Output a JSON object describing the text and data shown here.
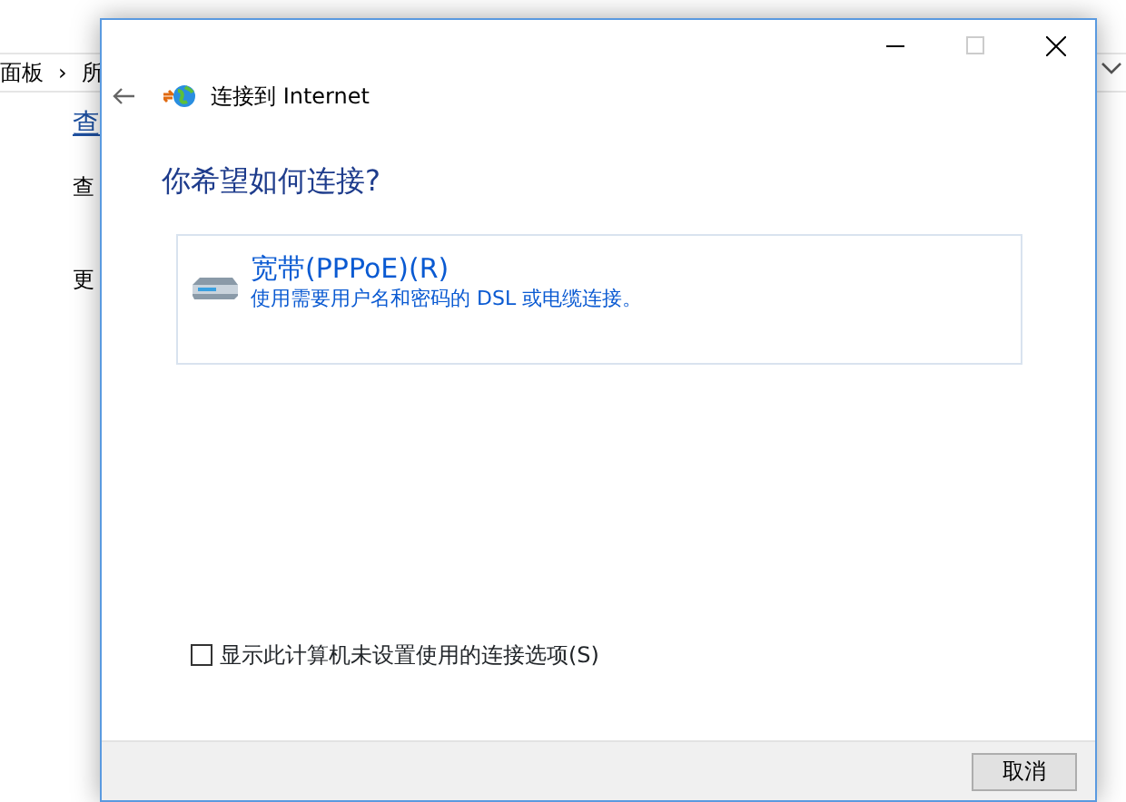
{
  "background_window": {
    "breadcrumb": [
      "面板",
      "›",
      "所"
    ],
    "items": [
      {
        "text": "查",
        "kind": "link"
      },
      {
        "text": "查",
        "kind": "text"
      },
      {
        "text": "更",
        "kind": "text"
      }
    ]
  },
  "dialog": {
    "title": "连接到 Internet",
    "heading": "你希望如何连接?",
    "options": [
      {
        "title": "宽带(PPPoE)(R)",
        "description": "使用需要用户名和密码的 DSL 或电缆连接。"
      }
    ],
    "show_unset_option": {
      "label": "显示此计算机未设置使用的连接选项(S)",
      "checked": false
    },
    "buttons": [
      "取消"
    ]
  }
}
